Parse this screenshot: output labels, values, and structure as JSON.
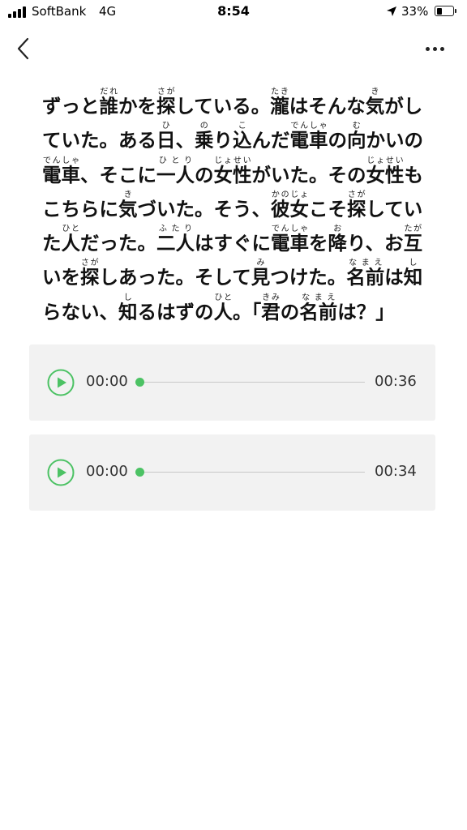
{
  "status_bar": {
    "carrier": "SoftBank",
    "network": "4G",
    "time": "8:54",
    "battery_percent": "33%",
    "battery_level": 0.33
  },
  "passage": {
    "segments": [
      {
        "t": "ずっと"
      },
      {
        "t": "誰",
        "r": "だれ"
      },
      {
        "t": "かを"
      },
      {
        "t": "探",
        "r": "さが"
      },
      {
        "t": "している。"
      },
      {
        "t": "瀧",
        "r": "たき"
      },
      {
        "t": "はそんな"
      },
      {
        "t": "気",
        "r": "き"
      },
      {
        "t": "がしていた。ある"
      },
      {
        "t": "日",
        "r": "ひ"
      },
      {
        "t": "、"
      },
      {
        "t": "乗",
        "r": "の"
      },
      {
        "t": "り"
      },
      {
        "t": "込",
        "r": "こ"
      },
      {
        "t": "んだ"
      },
      {
        "t": "電車",
        "r": "でんしゃ"
      },
      {
        "t": "の"
      },
      {
        "t": "向",
        "r": "む"
      },
      {
        "t": "かいの"
      },
      {
        "t": "電車",
        "r": "でんしゃ"
      },
      {
        "t": "、そこに"
      },
      {
        "t": "一人",
        "r": "ひとり"
      },
      {
        "t": "の"
      },
      {
        "t": "女性",
        "r": "じょせい"
      },
      {
        "t": "がいた。その"
      },
      {
        "t": "女性",
        "r": "じょせい"
      },
      {
        "t": "もこちらに"
      },
      {
        "t": "気",
        "r": "き"
      },
      {
        "t": "づいた。そう、"
      },
      {
        "t": "彼女",
        "r": "かのじょ"
      },
      {
        "t": "こそ"
      },
      {
        "t": "探",
        "r": "さが"
      },
      {
        "t": "していた"
      },
      {
        "t": "人",
        "r": "ひと"
      },
      {
        "t": "だった。"
      },
      {
        "t": "二人",
        "r": "ふたり"
      },
      {
        "t": "はすぐに"
      },
      {
        "t": "電車",
        "r": "でんしゃ"
      },
      {
        "t": "を"
      },
      {
        "t": "降",
        "r": "お"
      },
      {
        "t": "り、お"
      },
      {
        "t": "互",
        "r": "たが"
      },
      {
        "t": "いを"
      },
      {
        "t": "探",
        "r": "さが"
      },
      {
        "t": "しあった。そして"
      },
      {
        "t": "見",
        "r": "み"
      },
      {
        "t": "つけた。"
      },
      {
        "t": "名前",
        "r": "なまえ"
      },
      {
        "t": "は"
      },
      {
        "t": "知",
        "r": "し"
      },
      {
        "t": "らない、"
      },
      {
        "t": "知",
        "r": "し"
      },
      {
        "t": "るはずの"
      },
      {
        "t": "人",
        "r": "ひと"
      },
      {
        "t": "。「"
      },
      {
        "t": "君",
        "r": "きみ"
      },
      {
        "t": "の"
      },
      {
        "t": "名前",
        "r": "なまえ"
      },
      {
        "t": "は？」"
      }
    ]
  },
  "audio_players": [
    {
      "current_time": "00:00",
      "total_time": "00:36",
      "progress": 0
    },
    {
      "current_time": "00:00",
      "total_time": "00:34",
      "progress": 0
    }
  ],
  "colors": {
    "accent": "#4cc264",
    "player_background": "#f2f2f2",
    "track": "#c8c8c8"
  },
  "icons": {
    "back": "chevron-left-icon",
    "more": "more-horizontal-icon",
    "play": "play-circle-icon",
    "signal": "cellular-signal-icon",
    "location": "location-arrow-icon",
    "battery": "battery-icon"
  }
}
